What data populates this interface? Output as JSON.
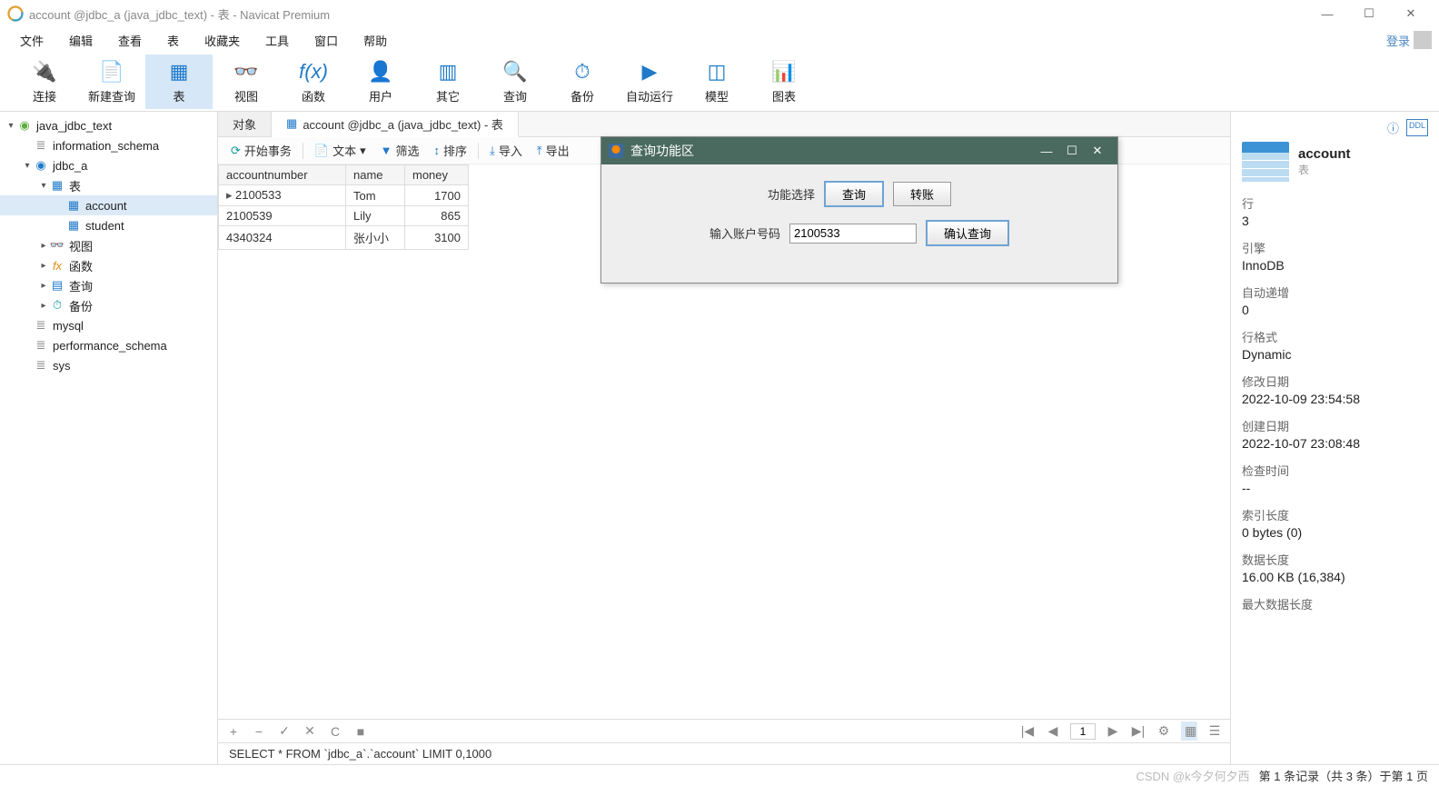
{
  "window": {
    "title": "account @jdbc_a (java_jdbc_text) - 表 - Navicat Premium"
  },
  "menu": [
    "文件",
    "编辑",
    "查看",
    "表",
    "收藏夹",
    "工具",
    "窗口",
    "帮助"
  ],
  "login_label": "登录",
  "toolbar": [
    {
      "label": "连接",
      "icon": "plug"
    },
    {
      "label": "新建查询",
      "icon": "sheet"
    },
    {
      "label": "表",
      "icon": "table",
      "active": true
    },
    {
      "label": "视图",
      "icon": "view"
    },
    {
      "label": "函数",
      "icon": "fx"
    },
    {
      "label": "用户",
      "icon": "user"
    },
    {
      "label": "其它",
      "icon": "other"
    },
    {
      "label": "查询",
      "icon": "query"
    },
    {
      "label": "备份",
      "icon": "backup"
    },
    {
      "label": "自动运行",
      "icon": "auto"
    },
    {
      "label": "模型",
      "icon": "model"
    },
    {
      "label": "图表",
      "icon": "chart"
    }
  ],
  "tree": [
    {
      "level": 0,
      "caret": "v",
      "icon": "db-green",
      "label": "java_jdbc_text"
    },
    {
      "level": 1,
      "caret": "",
      "icon": "schema",
      "label": "information_schema"
    },
    {
      "level": 1,
      "caret": "v",
      "icon": "db-blue",
      "label": "jdbc_a"
    },
    {
      "level": 2,
      "caret": "v",
      "icon": "folder",
      "label": "表"
    },
    {
      "level": 3,
      "caret": "",
      "icon": "table",
      "label": "account",
      "selected": true
    },
    {
      "level": 3,
      "caret": "",
      "icon": "table",
      "label": "student"
    },
    {
      "level": 2,
      "caret": ">",
      "icon": "view",
      "label": "视图"
    },
    {
      "level": 2,
      "caret": ">",
      "icon": "fx",
      "label": "函数"
    },
    {
      "level": 2,
      "caret": ">",
      "icon": "query",
      "label": "查询"
    },
    {
      "level": 2,
      "caret": ">",
      "icon": "backup",
      "label": "备份"
    },
    {
      "level": 1,
      "caret": "",
      "icon": "schema",
      "label": "mysql"
    },
    {
      "level": 1,
      "caret": "",
      "icon": "schema",
      "label": "performance_schema"
    },
    {
      "level": 1,
      "caret": "",
      "icon": "schema",
      "label": "sys"
    }
  ],
  "tabs": [
    {
      "label": "对象",
      "active": false
    },
    {
      "label": "account @jdbc_a (java_jdbc_text) - 表",
      "active": true,
      "icon": "table"
    }
  ],
  "subtoolbar": {
    "begin_tx": "开始事务",
    "text": "文本",
    "filter": "筛选",
    "sort": "排序",
    "import": "导入",
    "export": "导出"
  },
  "table": {
    "columns": [
      "accountnumber",
      "name",
      "money"
    ],
    "rows": [
      {
        "accountnumber": "2100533",
        "name": "Tom",
        "money": "1700",
        "current": true
      },
      {
        "accountnumber": "2100539",
        "name": "Lily",
        "money": "865"
      },
      {
        "accountnumber": "4340324",
        "name": "张小小",
        "money": "3100"
      }
    ]
  },
  "databar": {
    "page": "1"
  },
  "sql": "SELECT * FROM `jdbc_a`.`account` LIMIT 0,1000",
  "info": {
    "title": "account",
    "subtitle": "表",
    "sections": [
      {
        "label": "行",
        "value": "3"
      },
      {
        "label": "引擎",
        "value": "InnoDB"
      },
      {
        "label": "自动递增",
        "value": "0"
      },
      {
        "label": "行格式",
        "value": "Dynamic"
      },
      {
        "label": "修改日期",
        "value": "2022-10-09 23:54:58"
      },
      {
        "label": "创建日期",
        "value": "2022-10-07 23:08:48"
      },
      {
        "label": "检查时间",
        "value": "--"
      },
      {
        "label": "索引长度",
        "value": "0 bytes (0)"
      },
      {
        "label": "数据长度",
        "value": "16.00 KB (16,384)"
      },
      {
        "label": "最大数据长度",
        "value": ""
      }
    ]
  },
  "status": {
    "record_text": "第 1 条记录（共 3 条）于第 1 页",
    "watermark": "CSDN @k今夕何夕西"
  },
  "dialog": {
    "title": "查询功能区",
    "func_label": "功能选择",
    "btn_query": "查询",
    "btn_transfer": "转账",
    "input_label": "输入账户号码",
    "input_value": "2100533",
    "btn_confirm": "确认查询"
  }
}
